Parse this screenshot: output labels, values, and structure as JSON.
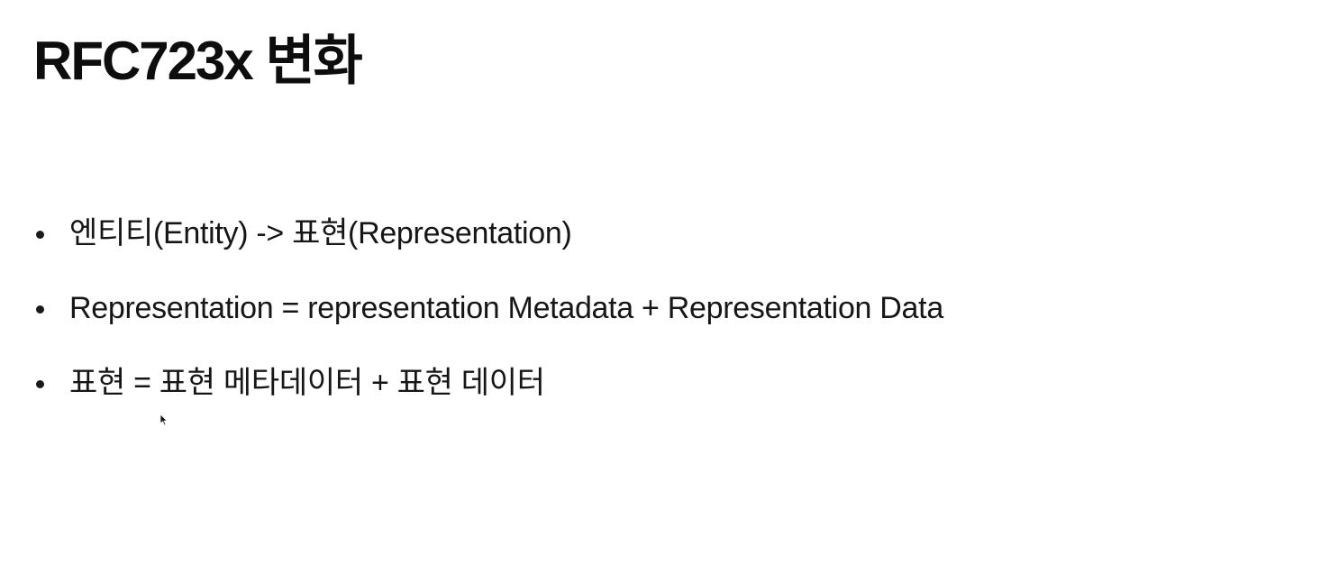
{
  "slide": {
    "title": "RFC723x 변화",
    "bullets": [
      "엔티티(Entity) -> 표현(Representation)",
      "Representation = representation Metadata + Representation Data",
      "표현 = 표현 메타데이터 + 표현 데이터"
    ]
  }
}
